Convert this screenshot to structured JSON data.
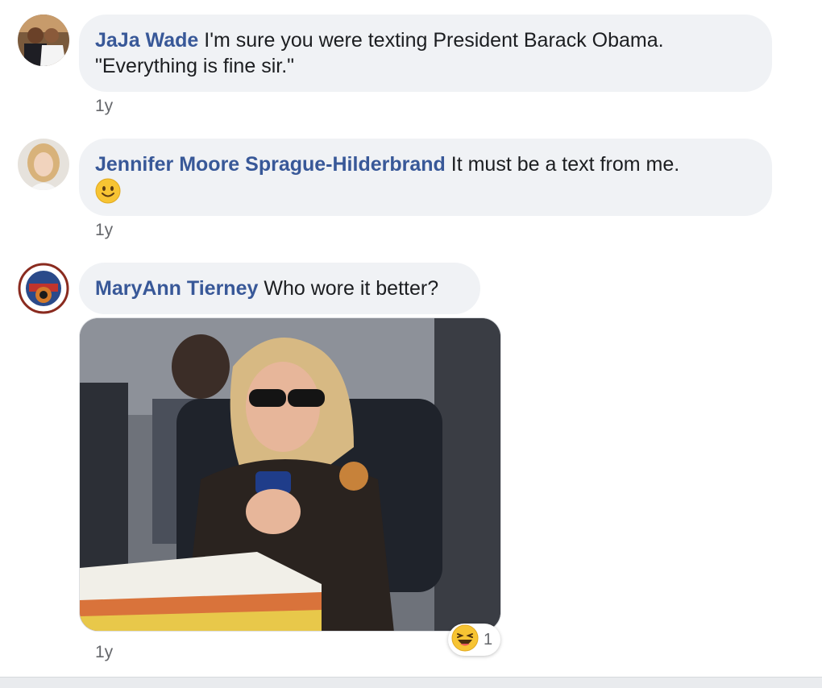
{
  "comments": [
    {
      "author": "JaJa Wade",
      "text_line1": "I'm sure you were texting President Barack Obama.",
      "text_line2": "\"Everything is fine sir.\"",
      "time": "1y"
    },
    {
      "author": "Jennifer Moore Sprague-Hilderbrand",
      "text_line1": "It must be a text from me.",
      "emoji": "slightly-smiling-face",
      "time": "1y"
    },
    {
      "author": "MaryAnn Tierney",
      "text_line1": "Who wore it better?",
      "attachment": "photo of woman in sunglasses using a phone",
      "reaction": {
        "type": "laughing-face",
        "count": "1"
      },
      "time": "1y"
    }
  ],
  "colors": {
    "author": "#385898",
    "bubble": "#f0f2f5",
    "timestamp": "#65676b"
  }
}
